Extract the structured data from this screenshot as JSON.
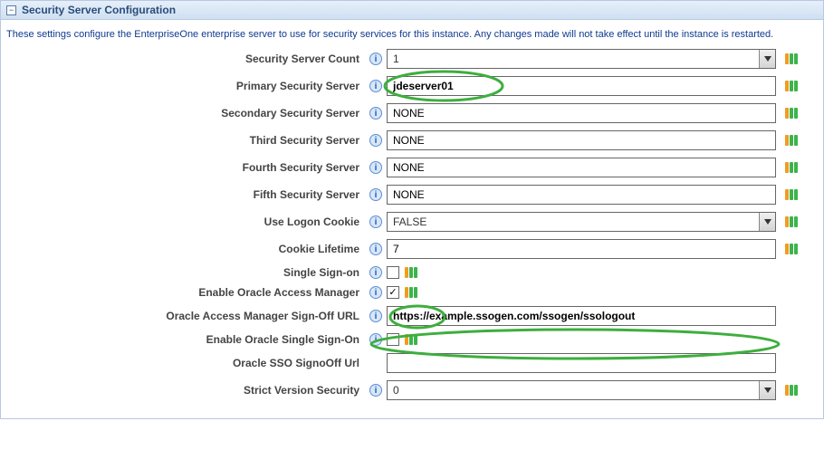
{
  "panel": {
    "title": "Security Server Configuration",
    "description": "These settings configure the EnterpriseOne enterprise server to use for security services for this instance. Any changes made will not take effect until the instance is restarted."
  },
  "fields": {
    "securityServerCount": {
      "label": "Security Server Count",
      "value": "1",
      "type": "select"
    },
    "primarySecurityServer": {
      "label": "Primary Security Server",
      "value": "jdeserver01",
      "type": "text",
      "bold": true
    },
    "secondarySecurityServer": {
      "label": "Secondary Security Server",
      "value": "NONE",
      "type": "text"
    },
    "thirdSecurityServer": {
      "label": "Third Security Server",
      "value": "NONE",
      "type": "text"
    },
    "fourthSecurityServer": {
      "label": "Fourth Security Server",
      "value": "NONE",
      "type": "text"
    },
    "fifthSecurityServer": {
      "label": "Fifth Security Server",
      "value": "NONE",
      "type": "text"
    },
    "useLogonCookie": {
      "label": "Use Logon Cookie",
      "value": "FALSE",
      "type": "select"
    },
    "cookieLifetime": {
      "label": "Cookie Lifetime",
      "value": "7",
      "type": "text"
    },
    "singleSignOn": {
      "label": "Single Sign-on",
      "checked": false,
      "type": "checkbox"
    },
    "enableOAM": {
      "label": "Enable Oracle Access Manager",
      "checked": true,
      "type": "checkbox"
    },
    "oamSignOffURL": {
      "label": "Oracle Access Manager Sign-Off URL",
      "value": "https://example.ssogen.com/ssogen/ssologout",
      "type": "text",
      "bold": true,
      "noTailIcon": true
    },
    "enableOSSO": {
      "label": "Enable Oracle Single Sign-On",
      "checked": false,
      "type": "checkbox"
    },
    "ossoSignOffURL": {
      "label": "Oracle SSO SignoOff Url",
      "value": "",
      "type": "text",
      "noInfoIcon": true,
      "noTailIcon": true
    },
    "strictVersionSecurity": {
      "label": "Strict Version Security",
      "value": "0",
      "type": "select"
    }
  }
}
